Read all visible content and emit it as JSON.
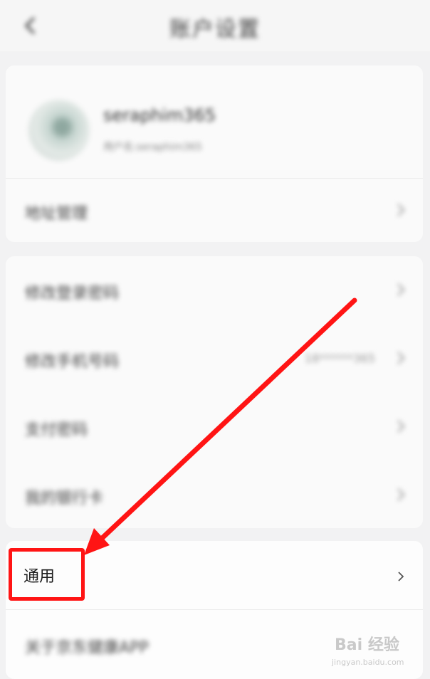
{
  "header": {
    "title": "账户设置"
  },
  "profile": {
    "name": "seraphim365",
    "subtitle": "用户名:seraphim365"
  },
  "sections": {
    "address": "地址管理",
    "change_password": "修改登录密码",
    "change_phone": "修改手机号码",
    "phone_masked": "18******365",
    "payment_password": "支付密码",
    "bank_cards": "我的银行卡",
    "general": "通用",
    "about": "关于京东健康APP"
  },
  "watermark": {
    "brand": "Bai 经验",
    "url": "jingyan.baidu.com"
  },
  "colors": {
    "annotation": "#ff1414"
  }
}
